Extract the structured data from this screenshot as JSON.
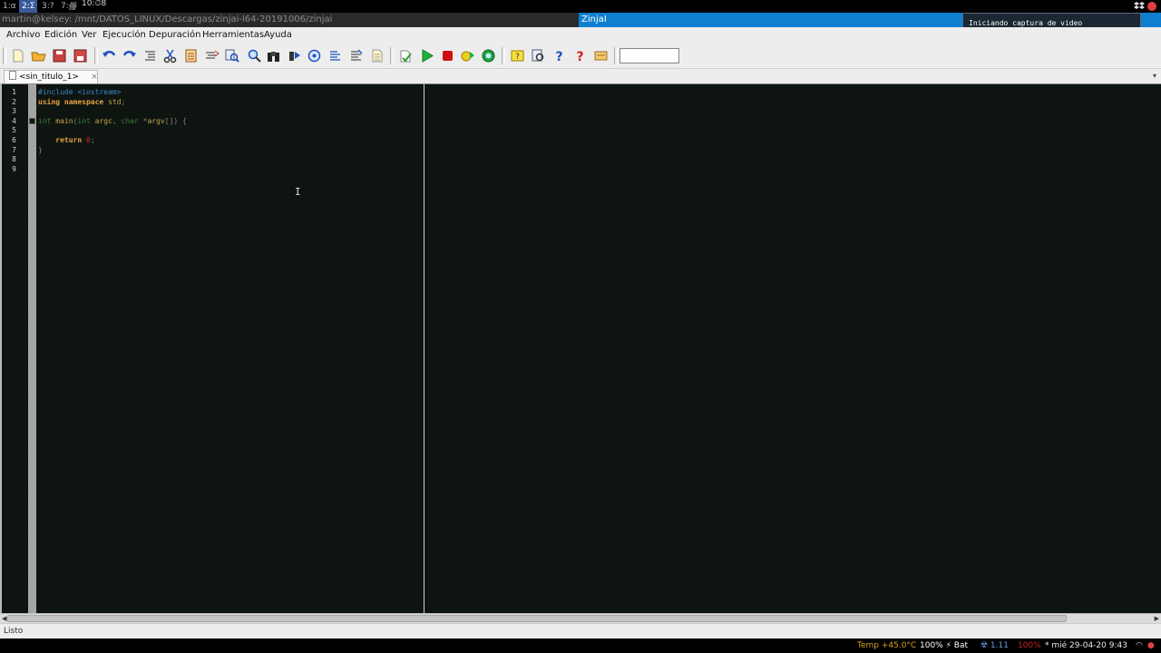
{
  "topbar": {
    "workspaces": [
      {
        "label": "1:α"
      },
      {
        "label": "2:Σ"
      },
      {
        "label": "3:?"
      },
      {
        "label": "7:∰"
      }
    ],
    "clock": "10:⏱8"
  },
  "window": {
    "terminal_title": "martin@kelsey: /mnt/DATOS_LINUX/Descargas/zinjai-l64-20191006/zinjai",
    "app_title": "ZinjaI"
  },
  "notification": {
    "text": "Iniciando captura de video"
  },
  "menu": {
    "items": [
      {
        "label": "Archivo"
      },
      {
        "label": "Edición"
      },
      {
        "label": "Ver"
      },
      {
        "label": "Ejecución"
      },
      {
        "label": "Depuración"
      },
      {
        "label": "Herramientas"
      },
      {
        "label": "Ayuda"
      }
    ]
  },
  "tabs": [
    {
      "label": "<sin_titulo_1>"
    }
  ],
  "editor": {
    "line_numbers": [
      "1",
      "2",
      "3",
      "4",
      "5",
      "6",
      "7",
      "8",
      "9"
    ]
  },
  "status": {
    "text": "Listo"
  },
  "system_bar": {
    "temp": "Temp +45.0°C",
    "battery": "100% ⚡ Bat",
    "load": "☢ 1.11",
    "volume": "100%",
    "datetime": "* mié 29-04-20  9:43"
  },
  "colors": {
    "title_accent": "#0e7fcf",
    "editor_bg": "#0e1511",
    "preprocessor": "#3a86c8",
    "keyword": "#e8a040",
    "number": "#c03030"
  }
}
